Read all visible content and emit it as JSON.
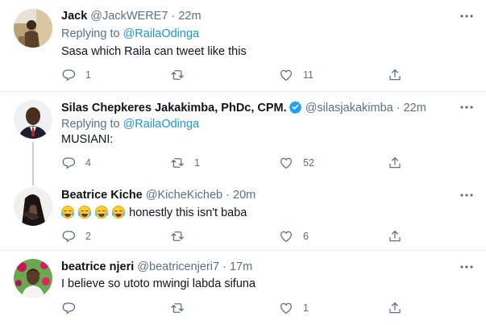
{
  "tweets": [
    {
      "name": "Jack",
      "handle": "@JackWERE7",
      "time": "22m",
      "replying_label": "Replying to",
      "replying_to": "@RailaOdinga",
      "text": "Sasa which Raila can tweet like this",
      "reply_count": "1",
      "retweet_count": "",
      "like_count": "11"
    },
    {
      "name": "Silas Chepkeres Jakakimba, PhDc, CPM.",
      "handle": "@silasjakakimba",
      "time": "22m",
      "replying_label": "Replying to",
      "replying_to": "@RailaOdinga",
      "text": "MUSIANI:",
      "reply_count": "4",
      "retweet_count": "1",
      "like_count": "52",
      "verified": true
    },
    {
      "name": "Beatrice Kiche",
      "handle": "@KicheKicheb",
      "time": "20m",
      "emoji_count": 4,
      "emoji_name": "face-with-tears-of-joy",
      "text": "honestly this isn't baba",
      "reply_count": "2",
      "retweet_count": "",
      "like_count": "6"
    },
    {
      "name": "beatrice njeri",
      "handle": "@beatricenjeri7",
      "time": "17m",
      "text": "I believe so utoto mwingi labda sifuna",
      "reply_count": "",
      "retweet_count": "",
      "like_count": "1"
    }
  ],
  "separator": "·",
  "colors": {
    "accent": "#1b95e0",
    "muted": "#5b7083",
    "text": "#0f1419",
    "verified": "#1da1f2"
  },
  "icons": [
    "reply-icon",
    "retweet-icon",
    "like-icon",
    "share-icon",
    "more-icon",
    "verified-badge-icon"
  ]
}
